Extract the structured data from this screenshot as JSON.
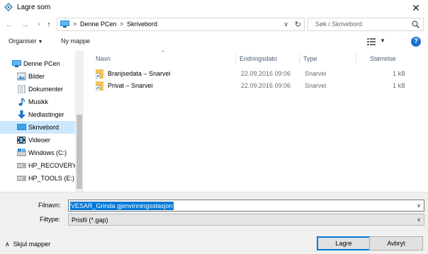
{
  "window": {
    "title": "Lagre som",
    "close_glyph": "✕"
  },
  "address": {
    "crumbs": [
      "Denne PCen",
      "Skrivebord"
    ],
    "separator": ">",
    "search_placeholder": "Søk i Skrivebord"
  },
  "toolbar": {
    "organize_label": "Organiser",
    "new_folder_label": "Ny mappe",
    "help_glyph": "?"
  },
  "sidebar": {
    "items": [
      {
        "label": "Denne PCen",
        "icon": "computer-icon"
      },
      {
        "label": "Bilder",
        "icon": "pictures-icon"
      },
      {
        "label": "Dokumenter",
        "icon": "documents-icon"
      },
      {
        "label": "Musikk",
        "icon": "music-icon"
      },
      {
        "label": "Nedlastinger",
        "icon": "downloads-icon"
      },
      {
        "label": "Skrivebord",
        "icon": "desktop-icon",
        "selected": true
      },
      {
        "label": "Videoer",
        "icon": "videos-icon"
      },
      {
        "label": "Windows (C:)",
        "icon": "drive-icon"
      },
      {
        "label": "HP_RECOVERY (",
        "icon": "drive-icon"
      },
      {
        "label": "HP_TOOLS (E:)",
        "icon": "drive-icon"
      }
    ]
  },
  "files": {
    "columns": {
      "name": "Navn",
      "date": "Endringsdato",
      "type": "Type",
      "size": "Størrelse"
    },
    "rows": [
      {
        "name": "Branjsedata – Snarvei",
        "date": "22.09.2016 09:06",
        "type": "Snarvei",
        "size": "1 kB"
      },
      {
        "name": "Privat – Snarvei",
        "date": "22.09.2016 09:06",
        "type": "Snarvei",
        "size": "1 kB"
      }
    ]
  },
  "save": {
    "filename_label": "Filnavn:",
    "filename_value": "VESAR_Grinda gjenvinningsstasjon",
    "filetype_label": "Filtype:",
    "filetype_value": "Prisfil (*.gap)",
    "hide_folders_label": "Skjul mapper",
    "save_label": "Lagre",
    "cancel_label": "Avbryt"
  },
  "colors": {
    "accent": "#0078d7",
    "selected_bg": "#cce8ff",
    "header_text": "#4c607a"
  }
}
